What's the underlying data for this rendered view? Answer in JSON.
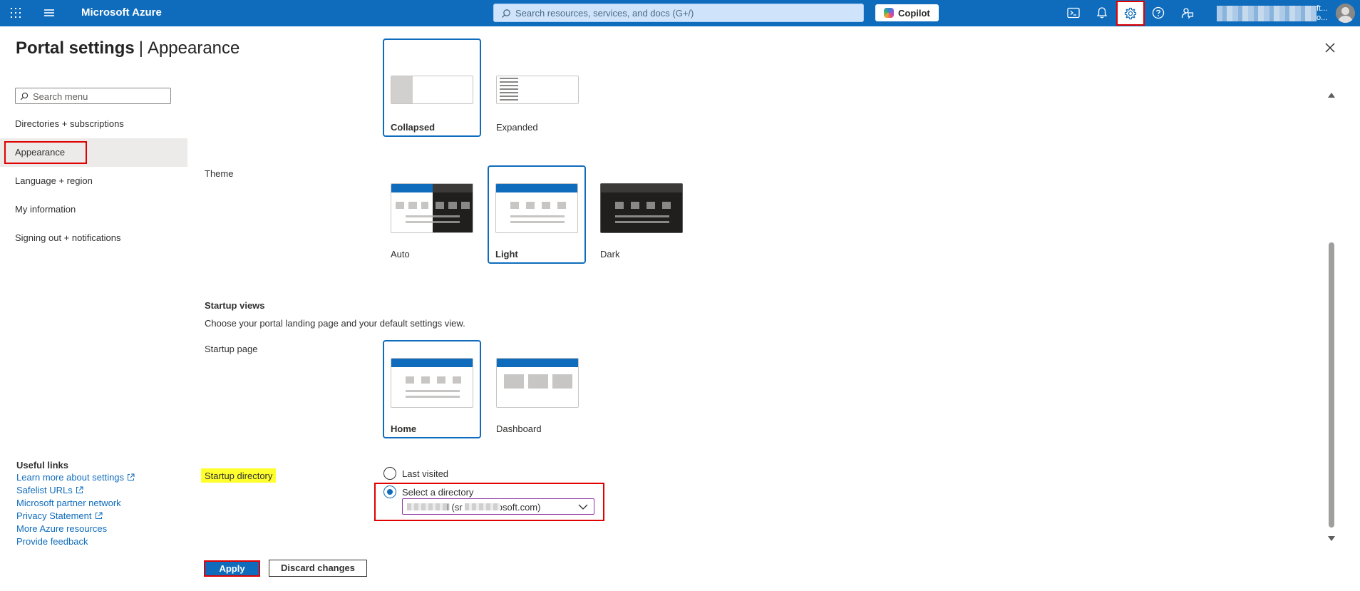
{
  "topbar": {
    "brand": "Microsoft Azure",
    "search_placeholder": "Search resources, services, and docs (G+/)",
    "copilot_label": "Copilot",
    "account_line1": "ft...",
    "account_line2": "o...",
    "accent_color": "#0f6cbd"
  },
  "page": {
    "title": "Portal settings",
    "separator": "|",
    "subtitle": "Appearance"
  },
  "menu": {
    "search_placeholder": "Search menu",
    "items": [
      {
        "label": "Directories + subscriptions"
      },
      {
        "label": "Appearance"
      },
      {
        "label": "Language + region"
      },
      {
        "label": "My information"
      },
      {
        "label": "Signing out + notifications"
      }
    ]
  },
  "useful_links": {
    "title": "Useful links",
    "links": [
      {
        "label": "Learn more about settings"
      },
      {
        "label": "Safelist URLs"
      },
      {
        "label": "Microsoft partner network"
      },
      {
        "label": "Privacy Statement"
      },
      {
        "label": "More Azure resources"
      },
      {
        "label": "Provide feedback"
      }
    ]
  },
  "menu_behavior": {
    "options": [
      {
        "label": "Collapsed",
        "selected": true
      },
      {
        "label": "Expanded",
        "selected": false
      }
    ]
  },
  "theme": {
    "label": "Theme",
    "options": [
      {
        "label": "Auto",
        "selected": false
      },
      {
        "label": "Light",
        "selected": true
      },
      {
        "label": "Dark",
        "selected": false
      }
    ]
  },
  "startup_views": {
    "heading": "Startup views",
    "description": "Choose your portal landing page and your default settings view.",
    "page_label": "Startup page",
    "options": [
      {
        "label": "Home",
        "selected": true
      },
      {
        "label": "Dashboard",
        "selected": false
      }
    ]
  },
  "startup_directory": {
    "label": "Startup directory",
    "options": [
      {
        "label": "Last visited",
        "checked": false
      },
      {
        "label": "Select a directory",
        "checked": true
      }
    ],
    "selected_value": "l (sr        l.onmicrosoft.com)"
  },
  "actions": {
    "apply": "Apply",
    "discard": "Discard changes"
  }
}
